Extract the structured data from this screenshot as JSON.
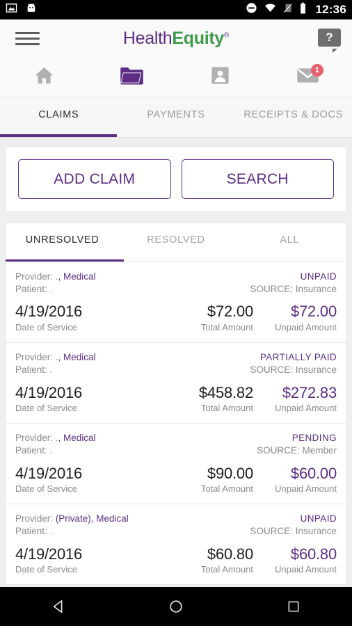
{
  "statusbar": {
    "time": "12:36",
    "icons": [
      "screenshot-icon",
      "android-head-icon",
      "do-not-disturb-icon",
      "wifi-icon",
      "no-sim-icon",
      "battery-icon"
    ]
  },
  "header": {
    "menu_label": "menu-icon",
    "logo_part1": "Health",
    "logo_part2": "Equity",
    "logo_reg": "®",
    "help_label": "?",
    "brand_purple": "#5c2d83",
    "brand_green": "#3d9b49"
  },
  "iconnav": {
    "items": [
      {
        "name": "home-icon",
        "active": false
      },
      {
        "name": "folder-icon",
        "active": true
      },
      {
        "name": "account-icon",
        "active": false
      },
      {
        "name": "message-icon",
        "active": false,
        "badge": "1"
      }
    ],
    "badge_color": "#e8606b"
  },
  "toptabs": {
    "items": [
      {
        "label": "CLAIMS",
        "active": true
      },
      {
        "label": "PAYMENTS",
        "active": false
      },
      {
        "label": "RECEIPTS & DOCS",
        "active": false
      }
    ]
  },
  "actions": {
    "add_claim_label": "ADD CLAIM",
    "search_label": "SEARCH"
  },
  "subtabs": {
    "items": [
      {
        "label": "UNRESOLVED",
        "active": true
      },
      {
        "label": "RESOLVED",
        "active": false
      },
      {
        "label": "ALL",
        "active": false
      }
    ]
  },
  "labels": {
    "provider_prefix": "Provider: .",
    "patient_line": "Patient: .",
    "date_of_service": "Date of Service",
    "total_amount": "Total Amount",
    "unpaid_amount": "Unpaid Amount"
  },
  "claims": [
    {
      "provider_prefix": "Provider: .",
      "provider_link": ", Medical",
      "patient": "Patient: .",
      "status": "UNPAID",
      "source": "SOURCE: Insurance",
      "date": "4/19/2016",
      "date_label": "Date of Service",
      "total": "$72.00",
      "total_label": "Total Amount",
      "unpaid": "$72.00",
      "unpaid_label": "Unpaid Amount"
    },
    {
      "provider_prefix": "Provider: .",
      "provider_link": ", Medical",
      "patient": "Patient: .",
      "status": "PARTIALLY PAID",
      "source": "SOURCE: Insurance",
      "date": "4/19/2016",
      "date_label": "Date of Service",
      "total": "$458.82",
      "total_label": "Total Amount",
      "unpaid": "$272.83",
      "unpaid_label": "Unpaid Amount"
    },
    {
      "provider_prefix": "Provider: .",
      "provider_link": ", Medical",
      "patient": "Patient: .",
      "status": "PENDING",
      "source": "SOURCE: Member",
      "date": "4/19/2016",
      "date_label": "Date of Service",
      "total": "$90.00",
      "total_label": "Total Amount",
      "unpaid": "$60.00",
      "unpaid_label": "Unpaid Amount"
    },
    {
      "provider_prefix": "Provider: ",
      "provider_link": "(Private), Medical",
      "patient": "Patient: .",
      "status": "UNPAID",
      "source": "SOURCE: Insurance",
      "date": "4/19/2016",
      "date_label": "Date of Service",
      "total": "$60.80",
      "total_label": "Total Amount",
      "unpaid": "$60.80",
      "unpaid_label": "Unpaid Amount"
    }
  ],
  "navbar": {
    "back": "back-triangle-icon",
    "home": "home-circle-icon",
    "recents": "recents-square-icon"
  }
}
